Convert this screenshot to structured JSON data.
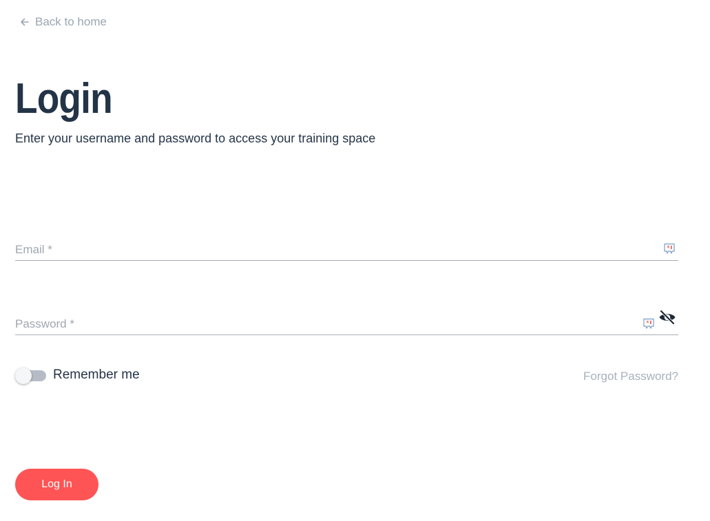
{
  "nav": {
    "back_label": "Back to home",
    "back_icon": "arrow-left-icon"
  },
  "header": {
    "title": "Login",
    "subtitle": "Enter your username and password to access your training space"
  },
  "form": {
    "email": {
      "label": "Email *",
      "value": ""
    },
    "password": {
      "label": "Password *",
      "value": ""
    },
    "remember": {
      "label": "Remember me",
      "checked": false
    },
    "forgot_label": "Forgot Password?",
    "submit_label": "Log In"
  },
  "colors": {
    "accent": "#ff5455",
    "heading": "#243447",
    "muted": "#a0a7b0"
  }
}
